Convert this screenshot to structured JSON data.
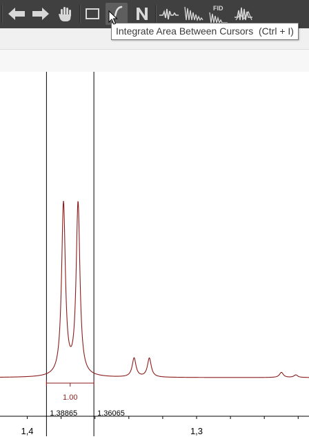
{
  "toolbar": {
    "buttons": [
      {
        "name": "back-button",
        "icon": "arrow-left-icon"
      },
      {
        "name": "forward-button",
        "icon": "arrow-right-icon"
      },
      {
        "name": "pan-button",
        "icon": "hand-icon"
      },
      {
        "name": "zoom-rectangle-button",
        "icon": "rectangle-icon"
      },
      {
        "name": "integrate-button",
        "icon": "integral-icon",
        "active": true
      },
      {
        "name": "normalize-button",
        "icon": "n-icon"
      },
      {
        "name": "peak-picking-button",
        "icon": "peaks-icon"
      },
      {
        "name": "decay-button",
        "icon": "decay-icon"
      },
      {
        "name": "fid-button",
        "icon": "fid-icon",
        "label": "FID"
      },
      {
        "name": "multiplet-button",
        "icon": "multiplet-icon"
      }
    ]
  },
  "tooltip": {
    "text": "Integrate Area Between Cursors  (Ctrl + I)"
  },
  "spectrum": {
    "line_color": "#8b1a1a",
    "cursors_ppm": [
      1.38865,
      1.36065
    ],
    "cursor_labels": [
      "1.38865",
      "1.36065"
    ],
    "integral_value": "1.00",
    "axis_tick_labels": [
      {
        "value": 1.4,
        "label": "1,4"
      },
      {
        "value": 1.3,
        "label": "1,3"
      }
    ],
    "axis_min_tick_step": 0.02,
    "x_range_ppm": [
      1.4161,
      1.2336
    ],
    "peaks": [
      {
        "ppm": 1.3786,
        "height": 1.0
      },
      {
        "ppm": 1.37,
        "height": 1.0
      },
      {
        "ppm": 1.3369,
        "height": 0.11
      },
      {
        "ppm": 1.3279,
        "height": 0.11
      },
      {
        "ppm": 1.2499,
        "height": 0.03
      },
      {
        "ppm": 1.2414,
        "height": 0.015
      }
    ]
  }
}
